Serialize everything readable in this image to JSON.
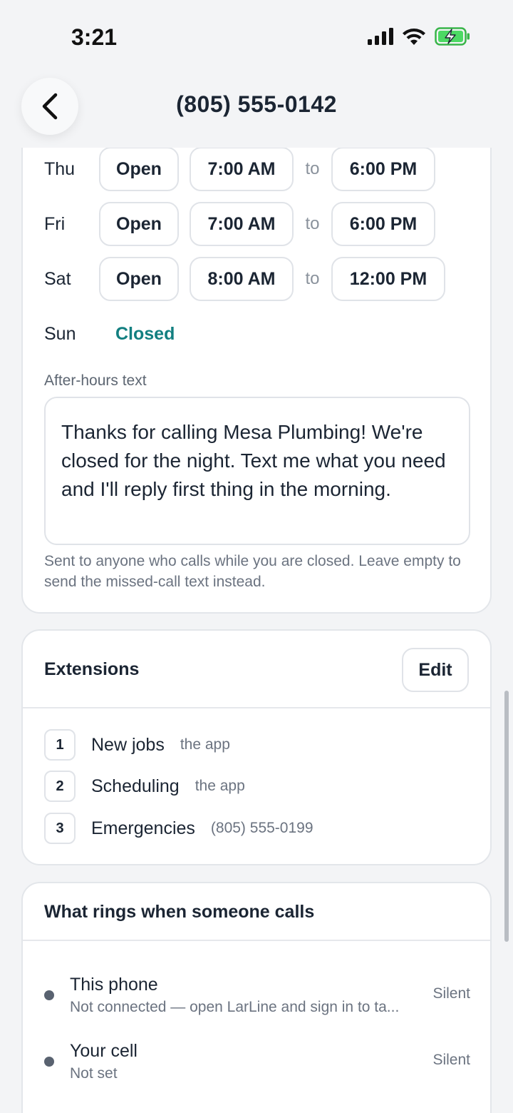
{
  "status_bar": {
    "time": "3:21"
  },
  "header": {
    "title": "(805) 555-0142"
  },
  "hours": {
    "rows": [
      {
        "day": "Thu",
        "state": "Open",
        "start": "7:00 AM",
        "sep": "to",
        "end": "6:00 PM"
      },
      {
        "day": "Fri",
        "state": "Open",
        "start": "7:00 AM",
        "sep": "to",
        "end": "6:00 PM"
      },
      {
        "day": "Sat",
        "state": "Open",
        "start": "8:00 AM",
        "sep": "to",
        "end": "12:00 PM"
      }
    ],
    "closed_day": {
      "day": "Sun",
      "state": "Closed"
    },
    "after_hours_label": "After-hours text",
    "after_hours_value": "Thanks for calling Mesa Plumbing! We're closed for the night. Text me what you need and I'll reply first thing in the morning.",
    "help_text": "Sent to anyone who calls while you are closed. Leave empty to send the missed-call text instead."
  },
  "extensions": {
    "title": "Extensions",
    "edit_label": "Edit",
    "items": [
      {
        "num": "1",
        "name": "New jobs",
        "target": "the app"
      },
      {
        "num": "2",
        "name": "Scheduling",
        "target": "the app"
      },
      {
        "num": "3",
        "name": "Emergencies",
        "target": "(805) 555-0199"
      }
    ]
  },
  "rings": {
    "title": "What rings when someone calls",
    "items": [
      {
        "name": "This phone",
        "sub": "Not connected — open LarLine and sign in to ta...",
        "status": "Silent"
      },
      {
        "name": "Your cell",
        "sub": "Not set",
        "status": "Silent"
      }
    ]
  },
  "colors": {
    "accent": "#127f80",
    "text": "#1b2533",
    "muted": "#6b7380",
    "border": "#e0e3e8"
  },
  "icons": {
    "back": "chevron-left-icon",
    "signal": "signal-icon",
    "wifi": "wifi-icon",
    "battery": "battery-charging-icon"
  }
}
